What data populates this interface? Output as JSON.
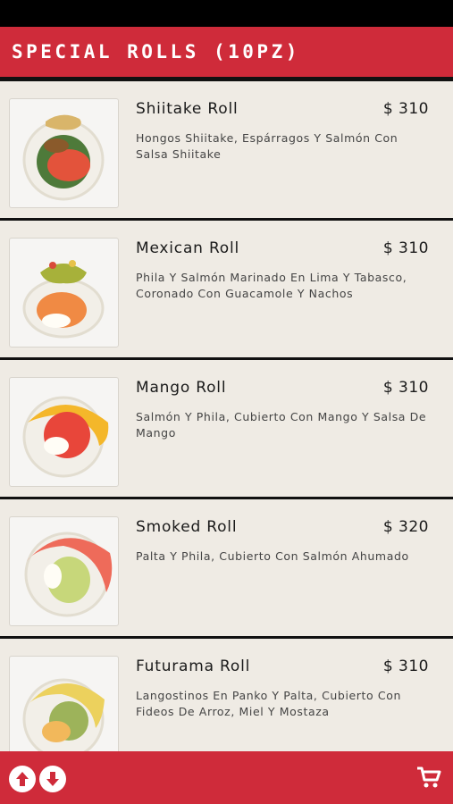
{
  "header": {
    "title": "SPECIAL ROLLS (10PZ)"
  },
  "items": [
    {
      "name": "Shiitake Roll",
      "price": "$ 310",
      "description": "Hongos Shiitake, Espárragos Y Salmón Con Salsa Shiitake",
      "image_icon": "shiitake-roll-image"
    },
    {
      "name": "Mexican Roll",
      "price": "$ 310",
      "description": "Phila Y Salmón Marinado En Lima Y Tabasco, Coronado Con Guacamole Y Nachos",
      "image_icon": "mexican-roll-image"
    },
    {
      "name": "Mango Roll",
      "price": "$ 310",
      "description": "Salmón Y Phila, Cubierto Con Mango Y Salsa De Mango",
      "image_icon": "mango-roll-image"
    },
    {
      "name": "Smoked Roll",
      "price": "$ 320",
      "description": "Palta Y Phila, Cubierto Con Salmón Ahumado",
      "image_icon": "smoked-roll-image"
    },
    {
      "name": "Futurama Roll",
      "price": "$ 310",
      "description": "Langostinos En Panko Y Palta, Cubierto Con Fideos De Arroz, Miel Y Mostaza",
      "image_icon": "futurama-roll-image"
    }
  ],
  "footer": {
    "icons": [
      "arrow-up-icon",
      "arrow-down-icon",
      "cart-icon"
    ]
  },
  "colors": {
    "brand_red": "#cf2b3a",
    "background": "#efebe4"
  }
}
